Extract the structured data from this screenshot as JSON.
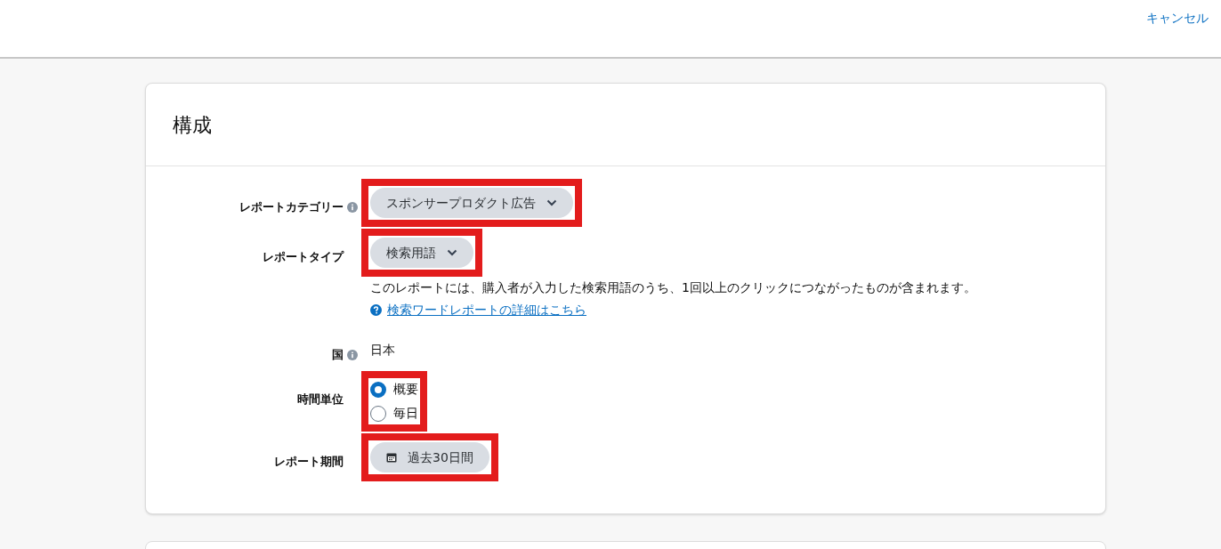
{
  "header": {
    "cancel": "キャンセル"
  },
  "card": {
    "title": "構成",
    "rows": [
      {
        "kind": "dropdown",
        "label": "レポートカテゴリー",
        "info": true,
        "highlighted": true,
        "value": "スポンサープロダクト広告"
      },
      {
        "kind": "dropdown",
        "label": "レポートタイプ",
        "info": false,
        "highlighted": true,
        "value": "検索用語",
        "description": "このレポートには、購入者が入力した検索用語のうち、1回以上のクリックにつながったものが含まれます。",
        "help_link": "検索ワードレポートの詳細はこちら"
      },
      {
        "kind": "text",
        "label": "国",
        "info": true,
        "highlighted": false,
        "value": "日本"
      },
      {
        "kind": "radio",
        "label": "時間単位",
        "info": false,
        "highlighted": true,
        "options": [
          {
            "label": "概要",
            "selected": true
          },
          {
            "label": "毎日",
            "selected": false
          }
        ]
      },
      {
        "kind": "date",
        "label": "レポート期間",
        "info": false,
        "highlighted": true,
        "value": "過去30日間"
      }
    ]
  }
}
